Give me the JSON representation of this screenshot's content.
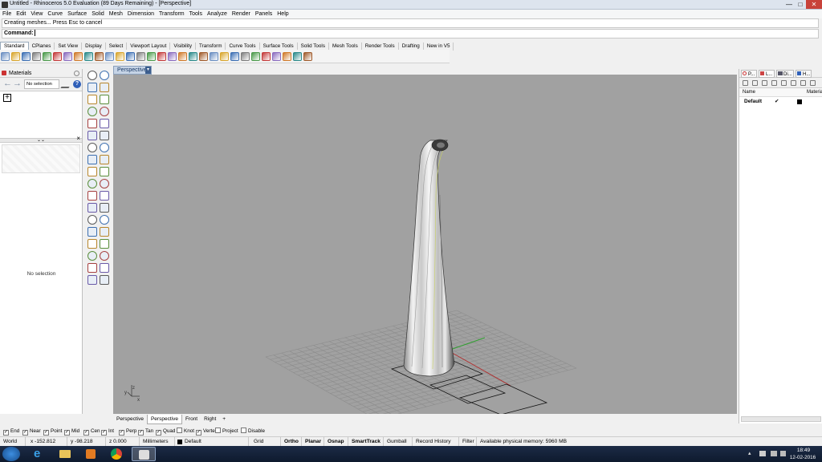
{
  "window": {
    "title": "Untitled - Rhinoceros 5.0 Evaluation (89 Days Remaining) - [Perspective]",
    "minimize": "—",
    "maximize": "□",
    "close": "✕"
  },
  "menu": [
    "File",
    "Edit",
    "View",
    "Curve",
    "Surface",
    "Solid",
    "Mesh",
    "Dimension",
    "Transform",
    "Tools",
    "Analyze",
    "Render",
    "Panels",
    "Help"
  ],
  "command": {
    "history": "Creating meshes... Press Esc to cancel",
    "prompt": "Command:"
  },
  "toolbar_tabs": [
    "Standard",
    "CPlanes",
    "Set View",
    "Display",
    "Select",
    "Viewport Layout",
    "Visibility",
    "Transform",
    "Curve Tools",
    "Surface Tools",
    "Solid Tools",
    "Mesh Tools",
    "Render Tools",
    "Drafting",
    "New in V5"
  ],
  "toolbar_icons": [
    "new-icon",
    "open-icon",
    "save-icon",
    "print-icon",
    "import-icon",
    "cut-icon",
    "copy-icon",
    "paste-icon",
    "undo-icon",
    "pan-icon",
    "rotate-icon",
    "zoom-icon",
    "zoom-window-icon",
    "zoom-extents-icon",
    "zoom-selected-icon",
    "undo-view-icon",
    "cplane-icon",
    "set-view-icon",
    "named-view-icon",
    "layer-icon",
    "light-icon",
    "properties-icon",
    "render-icon",
    "material-icon",
    "environment-icon",
    "sphere-render-icon",
    "options-icon",
    "grid-icon",
    "osnap-icon",
    "help-icon"
  ],
  "left_panel": {
    "tab": "Materials",
    "selection": "No selection",
    "help": "?",
    "add": "+",
    "splitter": "⌄⌄",
    "close": "×",
    "empty_text": "No selection"
  },
  "sidebar_icons": [
    "select-icon",
    "point-icon",
    "polyline-icon",
    "curve-icon",
    "circle-icon",
    "ellipse-icon",
    "arc-icon",
    "rectangle-icon",
    "polygon-icon",
    "fillet-icon",
    "surface-icon",
    "extrude-icon",
    "box-icon",
    "sphere-icon",
    "cylinder-icon",
    "boolean-icon",
    "mesh-icon",
    "explode-icon",
    "join-icon",
    "trim-icon",
    "split-icon",
    "offset-icon",
    "move-icon",
    "copy-obj-icon",
    "rotate-obj-icon",
    "scale-icon",
    "array-icon",
    "mirror-icon",
    "text-icon",
    "dimension-icon",
    "group-icon",
    "block-icon",
    "analyze-icon",
    "check-icon",
    "render-tool-icon",
    "paint-icon"
  ],
  "viewport": {
    "label": "Perspective",
    "dropdown": "▾",
    "tabs": [
      "Perspective",
      "Perspective",
      "Front",
      "Right"
    ],
    "add_tab": "+",
    "axis_z": "z",
    "axis_y": "y",
    "axis_x": "x"
  },
  "right_panel": {
    "tabs": [
      "P...",
      "L...",
      "Di...",
      "H..."
    ],
    "col_name": "Name",
    "col_material": "Material",
    "layer_name": "Default",
    "layer_check": "✔"
  },
  "osnaps": [
    {
      "label": "End",
      "checked": true
    },
    {
      "label": "Near",
      "checked": true
    },
    {
      "label": "Point",
      "checked": true
    },
    {
      "label": "Mid",
      "checked": true
    },
    {
      "label": "Cen",
      "checked": true
    },
    {
      "label": "Int",
      "checked": true
    },
    {
      "label": "Perp",
      "checked": true
    },
    {
      "label": "Tan",
      "checked": true
    },
    {
      "label": "Quad",
      "checked": true
    },
    {
      "label": "Knot",
      "checked": false
    },
    {
      "label": "Vertex",
      "checked": true
    },
    {
      "label": "Project",
      "checked": false
    },
    {
      "label": "Disable",
      "checked": false
    }
  ],
  "status": {
    "cplane": "World",
    "x": "x -152.812",
    "y": "y -98.218",
    "z": "z 0.000",
    "units": "Millimeters",
    "layer": "Default",
    "grid_snap": "Grid Snap",
    "ortho": "Ortho",
    "planar": "Planar",
    "osnap": "Osnap",
    "smarttrack": "SmartTrack",
    "gumball": "Gumball",
    "record_history": "Record History",
    "filter": "Filter",
    "memory": "Available physical memory: 5960 MB"
  },
  "taskbar": {
    "time": "18:49",
    "date": "12-02-2016"
  },
  "colors": {
    "viewport_bg": "#a1a1a1",
    "grid": "#8c8c8c",
    "x_axis": "#b03030",
    "y_axis": "#30a030",
    "taskbar": "#152440"
  }
}
